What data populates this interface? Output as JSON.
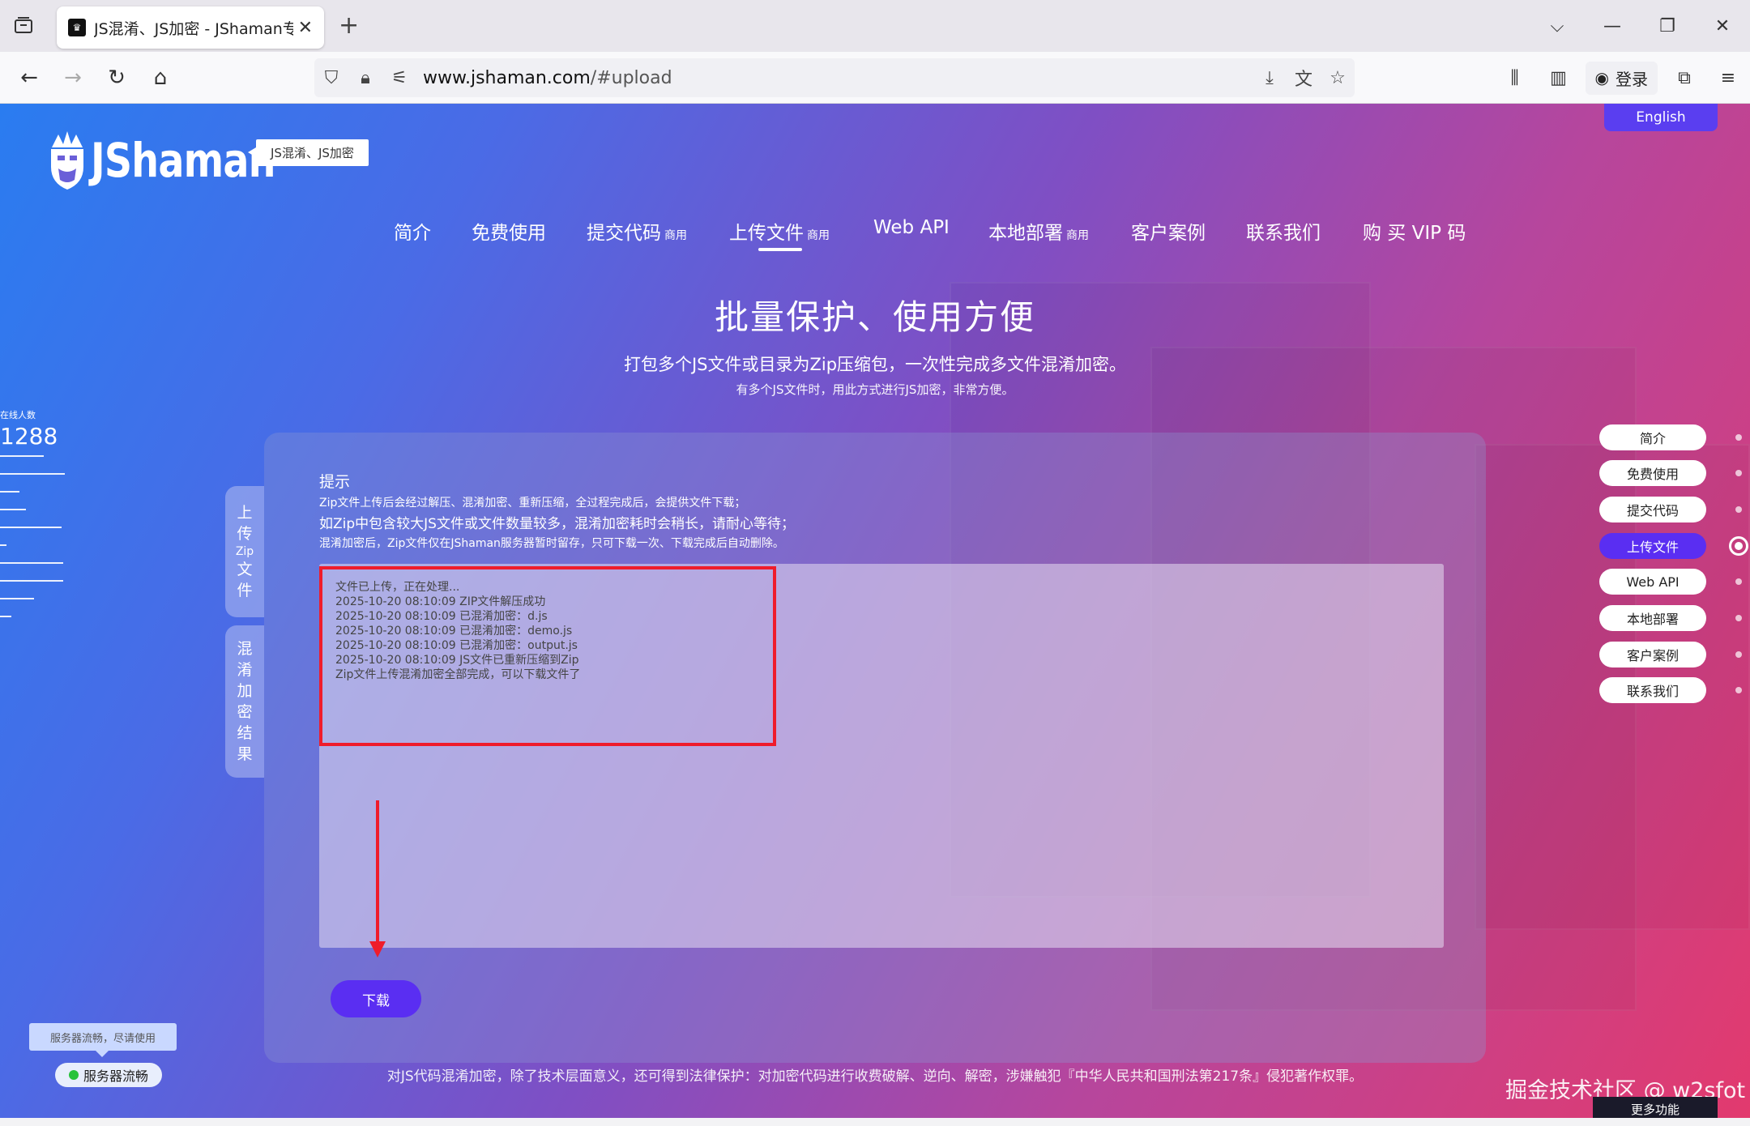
{
  "browser": {
    "tab_title": "JS混淆、JS加密 - JShaman专业",
    "tab_close": "✕",
    "new_tab": "+",
    "url_host": "www.jshaman.com",
    "url_path": "/#upload",
    "login_label": "登录"
  },
  "header": {
    "logo_text": "JShaman",
    "logo_tag": "JS混淆、JS加密",
    "english_button": "English"
  },
  "mainnav": {
    "items": [
      {
        "label": "简介",
        "badge": ""
      },
      {
        "label": "免费使用",
        "badge": ""
      },
      {
        "label": "提交代码",
        "badge": "商用"
      },
      {
        "label": "上传文件",
        "badge": "商用"
      },
      {
        "label": "Web API",
        "badge": ""
      },
      {
        "label": "本地部署",
        "badge": "商用"
      },
      {
        "label": "客户案例",
        "badge": ""
      },
      {
        "label": "联系我们",
        "badge": ""
      },
      {
        "label": "购 买 VIP 码",
        "badge": ""
      }
    ],
    "active_index": 3
  },
  "hero": {
    "title": "批量保护、使用方便",
    "subtitle": "打包多个JS文件或目录为Zip压缩包，一次性完成多文件混淆加密。",
    "subtitle2": "有多个JS文件时，用此方式进行JS加密，非常方便。"
  },
  "online": {
    "label": "在线人数",
    "count": "1288"
  },
  "panel": {
    "vtab_upload": [
      "上",
      "传",
      "Zip",
      "文",
      "件"
    ],
    "vtab_result": [
      "混",
      "淆",
      "加",
      "密",
      "结",
      "果"
    ],
    "tips_title": "提示",
    "tips": [
      "Zip文件上传后会经过解压、混淆加密、重新压缩，全过程完成后，会提供文件下载；",
      "如Zip中包含较大JS文件或文件数量较多，混淆加密耗时会稍长，请耐心等待；",
      "混淆加密后，Zip文件仅在JShaman服务器暂时留存，只可下载一次、下载完成后自动删除。"
    ],
    "log": [
      "文件已上传，正在处理...",
      "2025-10-20 08:10:09 ZIP文件解压成功",
      "2025-10-20 08:10:09 已混淆加密：d.js",
      "2025-10-20 08:10:09 已混淆加密：demo.js",
      "2025-10-20 08:10:09 已混淆加密：output.js",
      "2025-10-20 08:10:09 JS文件已重新压缩到Zip",
      "Zip文件上传混淆加密全部完成，可以下载文件了"
    ],
    "download_button": "下载"
  },
  "footer": {
    "note": "对JS代码混淆加密，除了技术层面意义，还可得到法律保护：对加密代码进行收费破解、逆向、解密，涉嫌触犯『中华人民共和国刑法第217条』侵犯著作权罪。",
    "server_tip": "服务器流畅，尽请使用",
    "server_status": "服务器流畅"
  },
  "sidenav": {
    "items": [
      "简介",
      "免费使用",
      "提交代码",
      "上传文件",
      "Web API",
      "本地部署",
      "客户案例",
      "联系我们"
    ],
    "active_index": 3
  },
  "watermark": "掘金技术社区 @ w2sfot",
  "more_functions": "更多功能",
  "colors": {
    "accent": "#5a2ef2",
    "annotation_red": "#ef1c2b",
    "status_green": "#27c23a"
  }
}
